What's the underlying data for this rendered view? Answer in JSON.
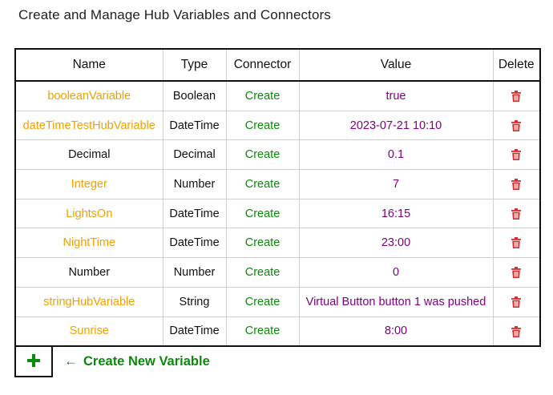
{
  "page": {
    "title": "Create and Manage Hub Variables and Connectors"
  },
  "table": {
    "headers": {
      "name": "Name",
      "type": "Type",
      "connector": "Connector",
      "value": "Value",
      "delete": "Delete"
    },
    "rows": [
      {
        "name": "booleanVariable",
        "name_color": "#f0a000",
        "type": "Boolean",
        "connector": "Create",
        "value": "true"
      },
      {
        "name": "dateTimeTestHubVariable",
        "name_color": "#f0a000",
        "type": "DateTime",
        "connector": "Create",
        "value": "2023-07-21 10:10"
      },
      {
        "name": "Decimal",
        "name_color": "#111111",
        "type": "Decimal",
        "connector": "Create",
        "value": "0.1"
      },
      {
        "name": "Integer",
        "name_color": "#f0a000",
        "type": "Number",
        "connector": "Create",
        "value": "7"
      },
      {
        "name": "LightsOn",
        "name_color": "#f0a000",
        "type": "DateTime",
        "connector": "Create",
        "value": "16:15"
      },
      {
        "name": "NightTime",
        "name_color": "#f0a000",
        "type": "DateTime",
        "connector": "Create",
        "value": "23:00"
      },
      {
        "name": "Number",
        "name_color": "#111111",
        "type": "Number",
        "connector": "Create",
        "value": "0"
      },
      {
        "name": "stringHubVariable",
        "name_color": "#f0a000",
        "type": "String",
        "connector": "Create",
        "value": "Virtual Button button 1 was pushed"
      },
      {
        "name": "Sunrise",
        "name_color": "#f0a000",
        "type": "DateTime",
        "connector": "Create",
        "value": "8:00"
      }
    ]
  },
  "footer": {
    "add_icon": "plus-icon",
    "arrow_icon": "arrow-left-icon",
    "arrow_glyph": "←",
    "create_label": "Create New Variable"
  },
  "colors": {
    "hub_name": "#f0a000",
    "connector": "#0a8a0a",
    "value": "#800080",
    "delete": "#d32f2f",
    "add": "#0a8a0a"
  }
}
